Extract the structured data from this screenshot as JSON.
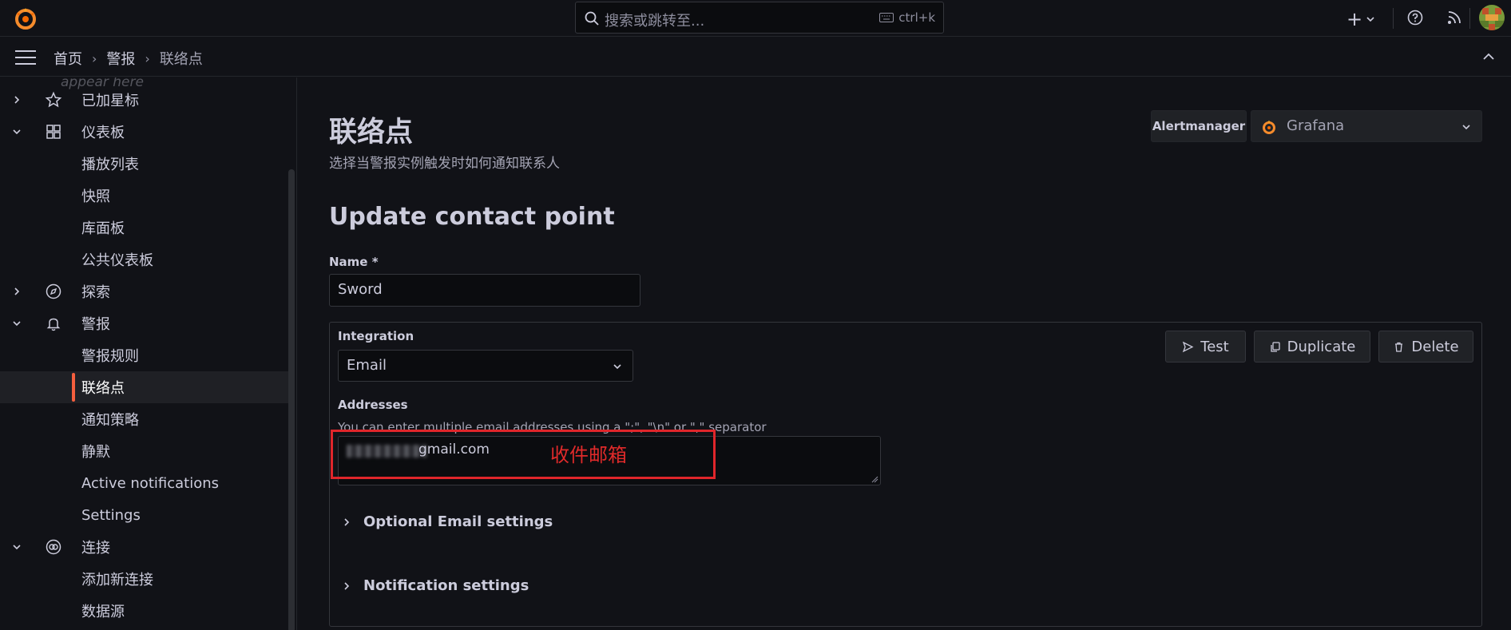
{
  "topbar": {
    "search_placeholder": "搜索或跳转至...",
    "shortcut": "ctrl+k"
  },
  "breadcrumb": [
    "首页",
    "警报",
    "联络点"
  ],
  "sidebar": {
    "faded_text": "appear here",
    "items": [
      {
        "label": "已加星标",
        "icon": "star-icon",
        "chevron": "right",
        "level": 0
      },
      {
        "label": "仪表板",
        "icon": "apps-icon",
        "chevron": "down",
        "level": 0
      },
      {
        "label": "播放列表",
        "level": 1
      },
      {
        "label": "快照",
        "level": 1
      },
      {
        "label": "库面板",
        "level": 1
      },
      {
        "label": "公共仪表板",
        "level": 1
      },
      {
        "label": "探索",
        "icon": "compass-icon",
        "chevron": "right",
        "level": 0
      },
      {
        "label": "警报",
        "icon": "bell-icon",
        "chevron": "down",
        "level": 0
      },
      {
        "label": "警报规则",
        "level": 1
      },
      {
        "label": "联络点",
        "level": 1,
        "active": true
      },
      {
        "label": "通知策略",
        "level": 1
      },
      {
        "label": "静默",
        "level": 1
      },
      {
        "label": "Active notifications",
        "level": 1
      },
      {
        "label": "Settings",
        "level": 1
      },
      {
        "label": "连接",
        "icon": "link-icon",
        "chevron": "down",
        "level": 0
      },
      {
        "label": "添加新连接",
        "level": 1
      },
      {
        "label": "数据源",
        "level": 1
      }
    ]
  },
  "page": {
    "title": "联络点",
    "subtitle": "选择当警报实例触发时如何通知联系人",
    "alertmanager_label": "Alertmanager",
    "alertmanager_value": "Grafana",
    "form_title": "Update contact point",
    "name_label": "Name *",
    "name_value": "Sword",
    "integration_label": "Integration",
    "integration_value": "Email",
    "buttons": {
      "test": "Test",
      "duplicate": "Duplicate",
      "delete": "Delete"
    },
    "addresses_label": "Addresses",
    "addresses_desc": "You can enter multiple email addresses using a \";\", \"\\n\" or \",\" separator",
    "addresses_value": "gmail.com",
    "annotation": "收件邮箱",
    "optional_settings": "Optional Email settings",
    "notification_settings": "Notification settings"
  },
  "colors": {
    "accent": "#f55f3e",
    "annotation": "#e0262b",
    "background": "#111217"
  }
}
